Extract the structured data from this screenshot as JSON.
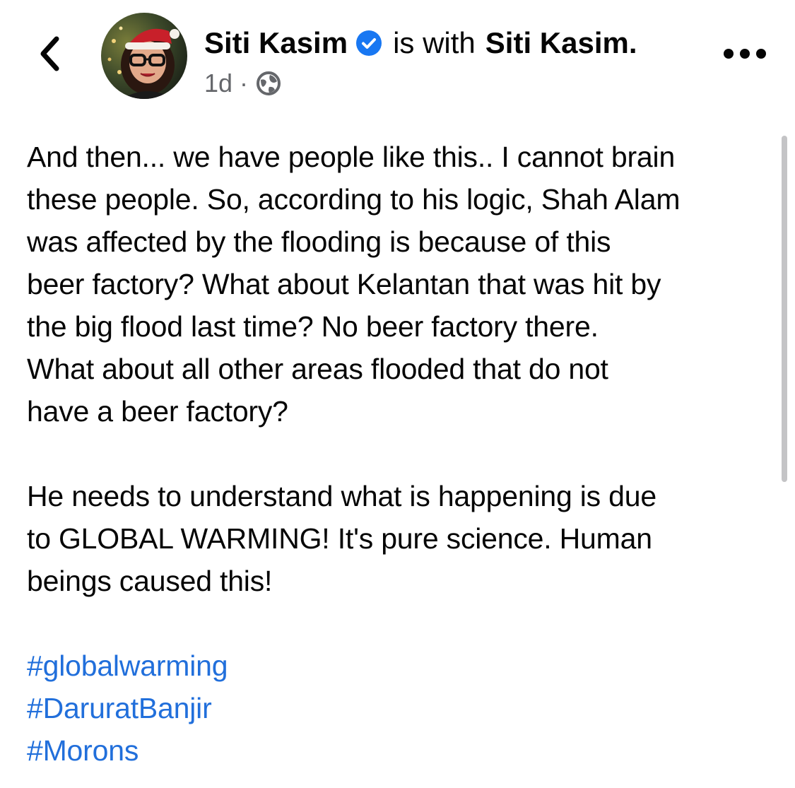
{
  "header": {
    "author_name": "Siti Kasim",
    "with_text": "is with",
    "tagged_name": "Siti Kasim.",
    "timestamp": "1d",
    "separator": "·",
    "icons": {
      "back": "chevron-left-icon",
      "verified": "verified-badge-icon",
      "audience": "globe-icon",
      "more": "more-options-icon"
    }
  },
  "post": {
    "paragraph1_lines": [
      "And then... we have people like this.. I cannot brain",
      "these people. So, according to his logic, Shah Alam",
      "was affected by the flooding is because of this",
      "beer factory? What about Kelantan that was hit by",
      "the big flood last time? No beer factory there.",
      "What about all other areas flooded that do not",
      "have a beer factory?"
    ],
    "paragraph2_lines": [
      "He needs to understand what is happening is due",
      "to GLOBAL WARMING! It's pure science. Human",
      "beings caused this!"
    ],
    "hashtags": [
      "#globalwarming",
      "#DaruratBanjir",
      "#Morons"
    ]
  },
  "colors": {
    "text": "#050505",
    "secondary_text": "#65676b",
    "link": "#216fdb",
    "verified_badge": "#1877f2",
    "scrollbar": "#c4c4c6"
  }
}
